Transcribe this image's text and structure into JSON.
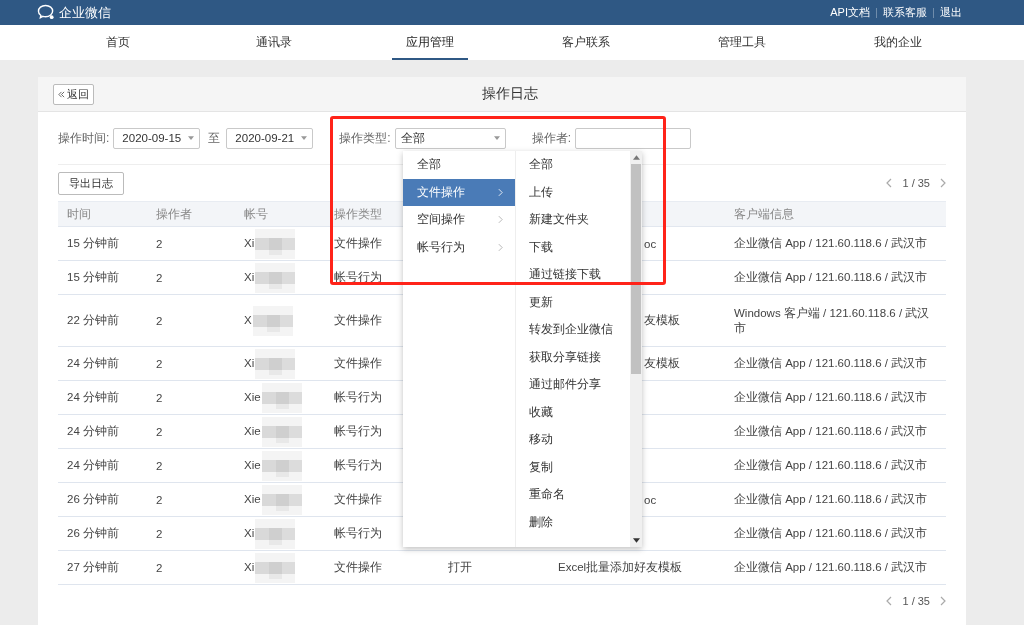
{
  "top_bar": {
    "brand": "企业微信",
    "links": [
      "API文档",
      "联系客服",
      "退出"
    ]
  },
  "nav": [
    {
      "label": "首页",
      "selected": false
    },
    {
      "label": "通讯录",
      "selected": false
    },
    {
      "label": "应用管理",
      "selected": true
    },
    {
      "label": "客户联系",
      "selected": false
    },
    {
      "label": "管理工具",
      "selected": false
    },
    {
      "label": "我的企业",
      "selected": false
    }
  ],
  "panel": {
    "back_button": "返回",
    "title": "操作日志"
  },
  "filters": {
    "time_label": "操作时间:",
    "date_from": "2020-09-15",
    "to_label": "至",
    "date_to": "2020-09-21",
    "type_label": "操作类型:",
    "type_value": "全部",
    "operator_label": "操作者:"
  },
  "export_button": "导出日志",
  "pagination_top": "1 / 35",
  "table": {
    "columns": [
      {
        "label": "时间"
      },
      {
        "label": "操作者"
      },
      {
        "label": "帐号"
      },
      {
        "label": "操作类型"
      },
      {},
      {},
      {
        "label": "客户端信息"
      }
    ],
    "rows": [
      {
        "time": "15 分钟前",
        "operator": "2",
        "account": "Xi",
        "type": "文件操作",
        "column_6": "oc",
        "column_6_covered": true,
        "client": "企业微信 App / 121.60.118.6 / 武汉市"
      },
      {
        "time": "15 分钟前",
        "operator": "2",
        "account": "Xi",
        "type": "帐号行为",
        "client": "企业微信 App / 121.60.118.6 / 武汉市"
      },
      {
        "time": "22 分钟前",
        "operator": "2",
        "account": "X",
        "type": "文件操作",
        "column_6": "友模板",
        "column_6_covered": true,
        "client": "Windows 客户端 / 121.60.118.6 / 武汉市"
      },
      {
        "time": "24 分钟前",
        "operator": "2",
        "account": "Xi",
        "type": "文件操作",
        "column_6": "友模板",
        "column_6_covered": true,
        "client": "企业微信 App / 121.60.118.6 / 武汉市"
      },
      {
        "time": "24 分钟前",
        "operator": "2",
        "account": "Xie",
        "type": "帐号行为",
        "client": "企业微信 App / 121.60.118.6 / 武汉市"
      },
      {
        "time": "24 分钟前",
        "operator": "2",
        "account": "Xie",
        "type": "帐号行为",
        "client": "企业微信 App / 121.60.118.6 / 武汉市"
      },
      {
        "time": "24 分钟前",
        "operator": "2",
        "account": "Xie",
        "type": "帐号行为",
        "client": "企业微信 App / 121.60.118.6 / 武汉市"
      },
      {
        "time": "26 分钟前",
        "operator": "2",
        "account": "Xie",
        "type": "文件操作",
        "column_6": "oc",
        "column_6_covered": true,
        "client": "企业微信 App / 121.60.118.6 / 武汉市"
      },
      {
        "time": "26 分钟前",
        "operator": "2",
        "account": "Xi",
        "type": "帐号行为",
        "client": "企业微信 App / 121.60.118.6 / 武汉市"
      },
      {
        "time": "27 分钟前",
        "operator": "2",
        "account": "Xi",
        "type": "文件操作",
        "column_5": "打开",
        "column_6": "Excel批量添加好友模板",
        "column_6_covered": false,
        "client": "企业微信 App / 121.60.118.6 / 武汉市"
      }
    ]
  },
  "pagination_bottom": "1 / 35",
  "type_dropdown": {
    "categories": [
      {
        "label": "全部",
        "selected": false,
        "has_submenu": false
      },
      {
        "label": "文件操作",
        "selected": true,
        "has_submenu": true
      },
      {
        "label": "空间操作",
        "selected": false,
        "has_submenu": true
      },
      {
        "label": "帐号行为",
        "selected": false,
        "has_submenu": true
      }
    ],
    "options": [
      "全部",
      "上传",
      "新建文件夹",
      "下载",
      "通过链接下载",
      "更新",
      "转发到企业微信",
      "获取分享链接",
      "通过邮件分享",
      "收藏",
      "移动",
      "复制",
      "重命名",
      "删除"
    ]
  },
  "annotation": {
    "highlight_frame": true
  }
}
